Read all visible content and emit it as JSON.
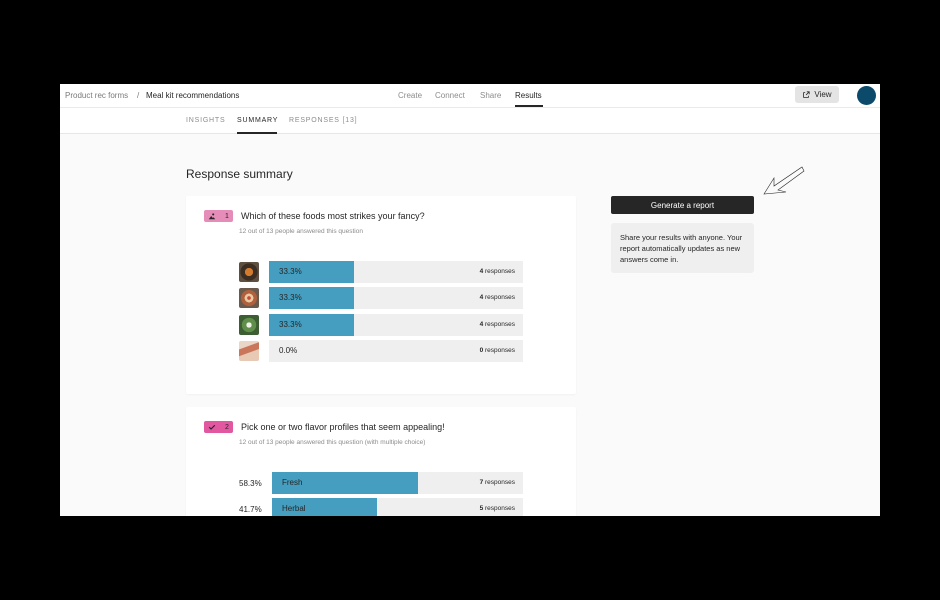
{
  "breadcrumb": {
    "root": "Product rec forms",
    "separator": "/",
    "current": "Meal kit recommendations"
  },
  "nav": {
    "create": "Create",
    "connect": "Connect",
    "share": "Share",
    "results": "Results"
  },
  "header": {
    "view_label": "View"
  },
  "subtabs": {
    "insights": "INSIGHTS",
    "summary": "SUMMARY",
    "responses": "RESPONSES [13]"
  },
  "page": {
    "title": "Response summary"
  },
  "questions": [
    {
      "number": "1",
      "title": "Which of these foods most strikes your fancy?",
      "subtitle": "12 out of 13 people answered this question",
      "answers": [
        {
          "percent": 0.333,
          "percent_label": "33.3%",
          "count": "4",
          "unit": "responses",
          "image": "food-bowl-dark"
        },
        {
          "percent": 0.333,
          "percent_label": "33.3%",
          "count": "4",
          "unit": "responses",
          "image": "food-pizza"
        },
        {
          "percent": 0.333,
          "percent_label": "33.3%",
          "count": "4",
          "unit": "responses",
          "image": "food-salad-green"
        },
        {
          "percent": 0.0,
          "percent_label": "0.0%",
          "count": "0",
          "unit": "responses",
          "image": "food-sandwich"
        }
      ]
    },
    {
      "number": "2",
      "title": "Pick one or two flavor profiles that seem appealing!",
      "subtitle": "12 out of 13 people answered this question (with multiple choice)",
      "answers": [
        {
          "percent": 0.583,
          "percent_label": "58.3%",
          "label": "Fresh",
          "count": "7",
          "unit": "responses"
        },
        {
          "percent": 0.417,
          "percent_label": "41.7%",
          "label": "Herbal",
          "count": "5",
          "unit": "responses"
        }
      ]
    }
  ],
  "sidebar": {
    "generate_label": "Generate a report",
    "share_text": "Share your results with anyone. Your report automatically updates as new answers come in."
  },
  "colors": {
    "bar_fill": "#459ebf",
    "bar_track": "#efefef",
    "badge_q1": "#e58cb8",
    "badge_q2": "#e157a0",
    "avatar": "#0b4a6a",
    "button_dark": "#262627"
  },
  "icons": {
    "q1_type": "picture-choice-icon",
    "q2_type": "checkmark-icon",
    "view": "external-link-icon"
  }
}
